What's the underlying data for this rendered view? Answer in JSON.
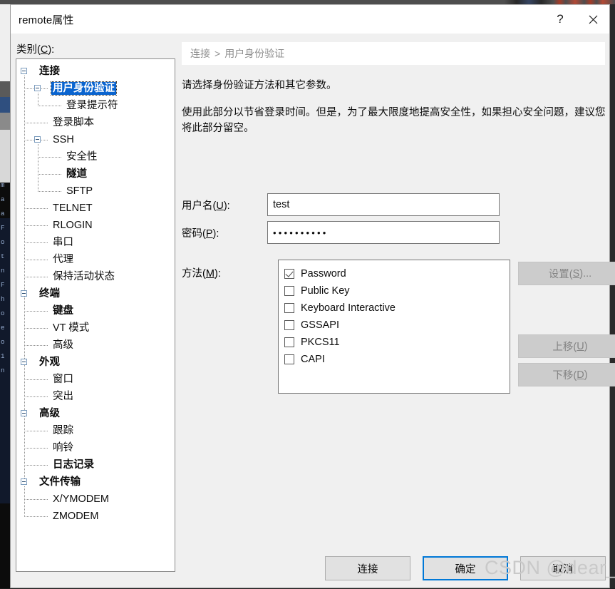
{
  "window": {
    "title": "remote属性",
    "help_button": "?",
    "close_button": "✕"
  },
  "sidebar": {
    "label_prefix": "类别(",
    "label_accel": "C",
    "label_suffix": "):",
    "tree": [
      {
        "label": "连接",
        "level": 0,
        "bold": true,
        "expander": true,
        "selected": false
      },
      {
        "label": "用户身份验证",
        "level": 1,
        "bold": true,
        "expander": true,
        "selected": true
      },
      {
        "label": "登录提示符",
        "level": 2,
        "bold": false,
        "expander": false,
        "selected": false
      },
      {
        "label": "登录脚本",
        "level": 1,
        "bold": false,
        "expander": false,
        "selected": false
      },
      {
        "label": "SSH",
        "level": 1,
        "bold": false,
        "expander": true,
        "selected": false
      },
      {
        "label": "安全性",
        "level": 2,
        "bold": false,
        "expander": false,
        "selected": false
      },
      {
        "label": "隧道",
        "level": 2,
        "bold": true,
        "expander": false,
        "selected": false
      },
      {
        "label": "SFTP",
        "level": 2,
        "bold": false,
        "expander": false,
        "selected": false
      },
      {
        "label": "TELNET",
        "level": 1,
        "bold": false,
        "expander": false,
        "selected": false
      },
      {
        "label": "RLOGIN",
        "level": 1,
        "bold": false,
        "expander": false,
        "selected": false
      },
      {
        "label": "串口",
        "level": 1,
        "bold": false,
        "expander": false,
        "selected": false
      },
      {
        "label": "代理",
        "level": 1,
        "bold": false,
        "expander": false,
        "selected": false
      },
      {
        "label": "保持活动状态",
        "level": 1,
        "bold": false,
        "expander": false,
        "selected": false
      },
      {
        "label": "终端",
        "level": 0,
        "bold": true,
        "expander": true,
        "selected": false
      },
      {
        "label": "键盘",
        "level": 1,
        "bold": true,
        "expander": false,
        "selected": false
      },
      {
        "label": "VT 模式",
        "level": 1,
        "bold": false,
        "expander": false,
        "selected": false
      },
      {
        "label": "高级",
        "level": 1,
        "bold": false,
        "expander": false,
        "selected": false
      },
      {
        "label": "外观",
        "level": 0,
        "bold": true,
        "expander": true,
        "selected": false
      },
      {
        "label": "窗口",
        "level": 1,
        "bold": false,
        "expander": false,
        "selected": false
      },
      {
        "label": "突出",
        "level": 1,
        "bold": false,
        "expander": false,
        "selected": false
      },
      {
        "label": "高级",
        "level": 0,
        "bold": true,
        "expander": true,
        "selected": false
      },
      {
        "label": "跟踪",
        "level": 1,
        "bold": false,
        "expander": false,
        "selected": false
      },
      {
        "label": "响铃",
        "level": 1,
        "bold": false,
        "expander": false,
        "selected": false
      },
      {
        "label": "日志记录",
        "level": 1,
        "bold": true,
        "expander": false,
        "selected": false
      },
      {
        "label": "文件传输",
        "level": 0,
        "bold": true,
        "expander": true,
        "selected": false
      },
      {
        "label": "X/YMODEM",
        "level": 1,
        "bold": false,
        "expander": false,
        "selected": false
      },
      {
        "label": "ZMODEM",
        "level": 1,
        "bold": false,
        "expander": false,
        "selected": false
      }
    ]
  },
  "main": {
    "breadcrumb": {
      "root": "连接",
      "separator": ">",
      "current": "用户身份验证"
    },
    "description_1": "请选择身份验证方法和其它参数。",
    "description_2": "使用此部分以节省登录时间。但是，为了最大限度地提高安全性，如果担心安全问题，建议您将此部分留空。",
    "username": {
      "label_prefix": "用户名(",
      "label_accel": "U",
      "label_suffix": "):",
      "value": "test"
    },
    "password": {
      "label_prefix": "密码(",
      "label_accel": "P",
      "label_suffix": "):",
      "value": "••••••••••",
      "dot_count": 10
    },
    "methods": {
      "label_prefix": "方法(",
      "label_accel": "M",
      "label_suffix": "):",
      "items": [
        {
          "label": "Password",
          "checked": true
        },
        {
          "label": "Public Key",
          "checked": false
        },
        {
          "label": "Keyboard Interactive",
          "checked": false
        },
        {
          "label": "GSSAPI",
          "checked": false
        },
        {
          "label": "PKCS11",
          "checked": false
        },
        {
          "label": "CAPI",
          "checked": false
        }
      ]
    },
    "side_buttons": [
      {
        "prefix": "设置(",
        "accel": "S",
        "suffix": ")...",
        "enabled": false
      },
      {
        "prefix": "上移(",
        "accel": "U",
        "suffix": ")",
        "enabled": false
      },
      {
        "prefix": "下移(",
        "accel": "D",
        "suffix": ")",
        "enabled": false
      }
    ]
  },
  "footer": {
    "connect": "连接",
    "ok": "确定",
    "cancel": "取消"
  },
  "watermark": "CSDN @dear_queen",
  "colors": {
    "selection_blue": "#0a64cf",
    "focus_border": "#0078d7",
    "dialog_bg": "#f0f0f0",
    "panel_white": "#ffffff",
    "disabled_text": "#848484",
    "breadcrumb_text": "#8e8e8e"
  }
}
